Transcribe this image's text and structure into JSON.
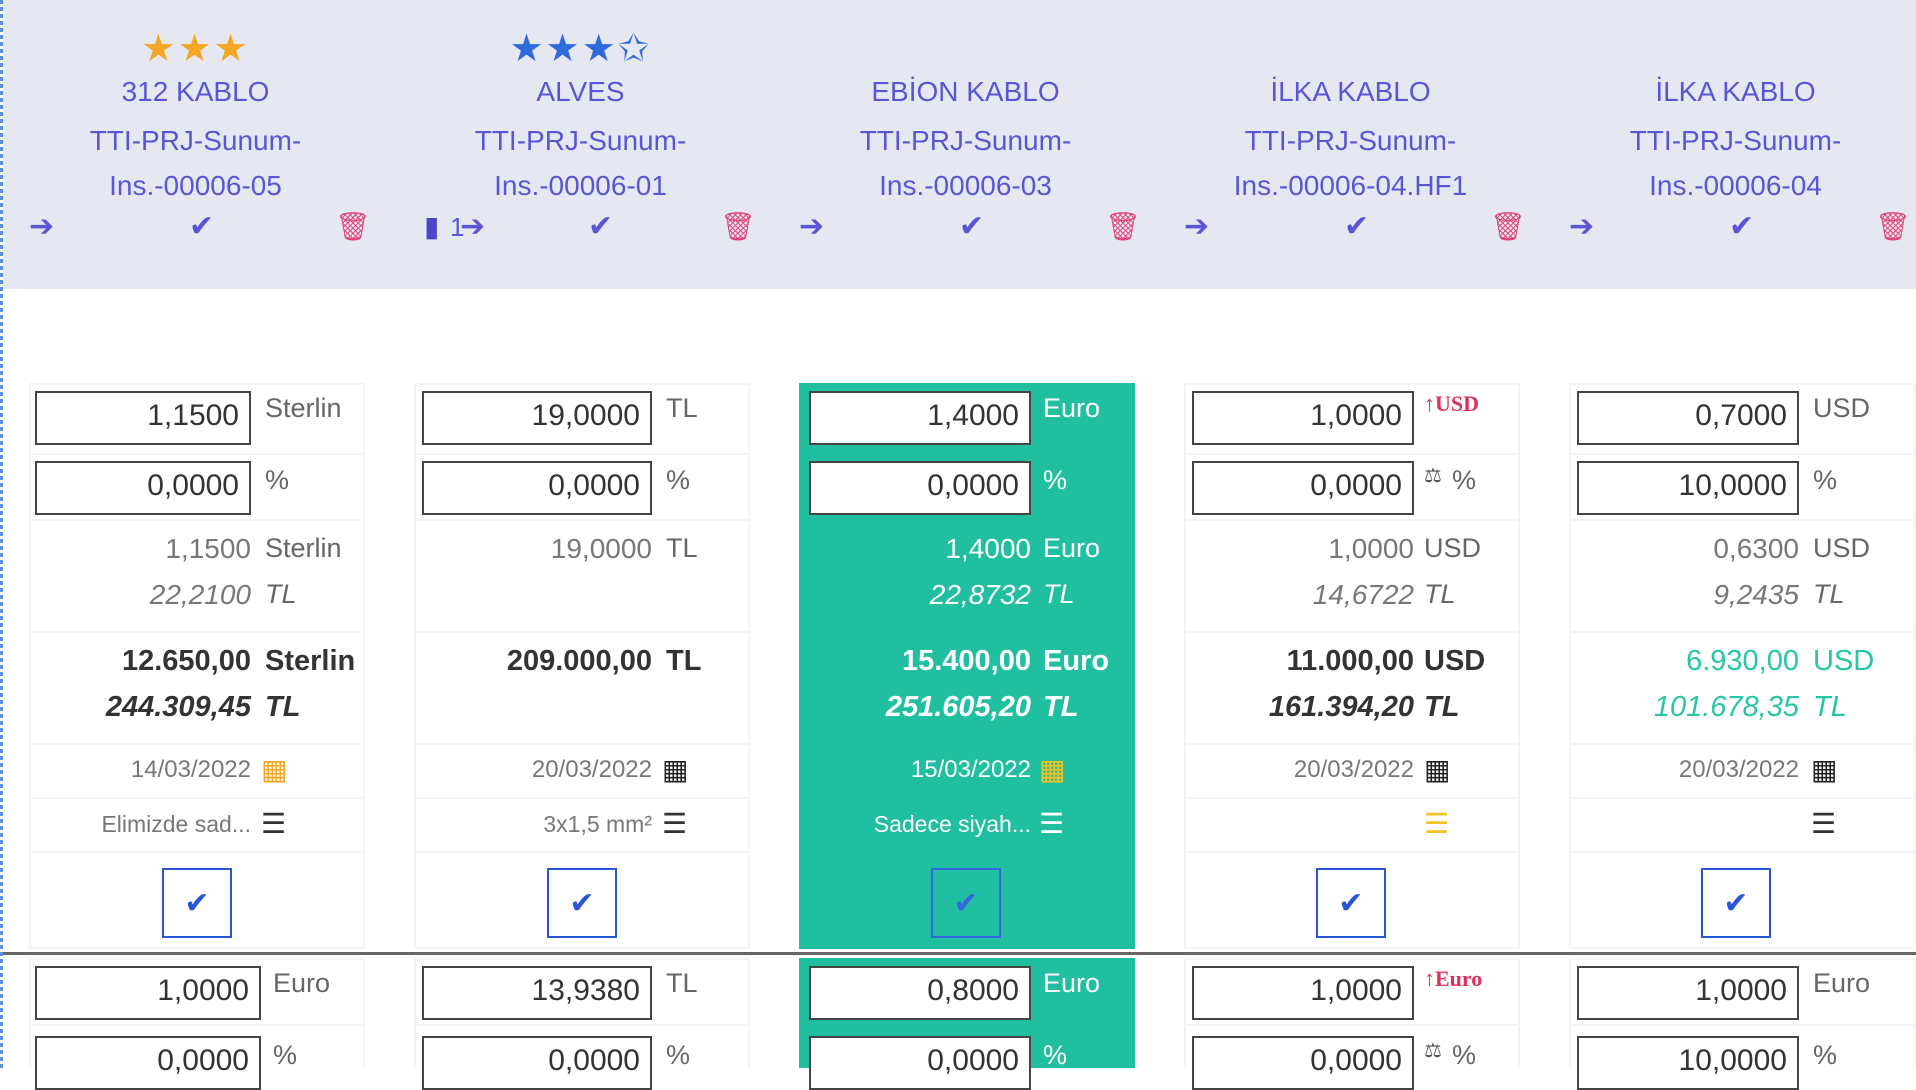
{
  "suppliers": [
    {
      "stars": "★★★",
      "name": "312 KABLO",
      "ref1": "TTI-PRJ-Sunum-",
      "ref2": "Ins.-00006-05"
    },
    {
      "stars": "★★★✩",
      "name": "ALVES",
      "ref1": "TTI-PRJ-Sunum-",
      "ref2": "Ins.-00006-01",
      "doc_label": "1"
    },
    {
      "stars": "",
      "name": "EBİON KABLO",
      "ref1": "TTI-PRJ-Sunum-",
      "ref2": "Ins.-00006-03"
    },
    {
      "stars": "",
      "name": "İLKA KABLO",
      "ref1": "TTI-PRJ-Sunum-",
      "ref2": "Ins.-00006-04.HF1"
    },
    {
      "stars": "",
      "name": "İLKA KABLO",
      "ref1": "TTI-PRJ-Sunum-",
      "ref2": "Ins.-00006-04"
    }
  ],
  "icons": {
    "arrow": "arrow-right-icon",
    "check": "check-icon",
    "trash": "trash-icon",
    "calendar": "calendar-icon",
    "comment": "comment-icon",
    "file": "file-icon"
  },
  "row1": [
    {
      "price": "1,1500",
      "currency": "Sterlin",
      "discount": "0,0000",
      "pct": "%",
      "net": "1,1500",
      "net_cur": "Sterlin",
      "net_tl": "22,2100",
      "tl": "TL",
      "total": "12.650,00",
      "total_cur": "Sterlin",
      "total_tl": "244.309,45",
      "date": "14/03/2022",
      "note": "Elimizde sad..."
    },
    {
      "price": "19,0000",
      "currency": "TL",
      "discount": "0,0000",
      "pct": "%",
      "net": "19,0000",
      "net_cur": "TL",
      "net_tl": "",
      "tl": "",
      "total": "209.000,00",
      "total_cur": "TL",
      "total_tl": "",
      "date": "20/03/2022",
      "note": "3x1,5 mm²"
    },
    {
      "price": "1,4000",
      "currency": "Euro",
      "discount": "0,0000",
      "pct": "%",
      "net": "1,4000",
      "net_cur": "Euro",
      "net_tl": "22,8732",
      "tl": "TL",
      "total": "15.400,00",
      "total_cur": "Euro",
      "total_tl": "251.605,20",
      "date": "15/03/2022",
      "note": "Sadece siyah..."
    },
    {
      "price": "1,0000",
      "currency": "↑USD",
      "discount": "0,0000",
      "pct": "%",
      "net": "1,0000",
      "net_cur": "USD",
      "net_tl": "14,6722",
      "tl": "TL",
      "total": "11.000,00",
      "total_cur": "USD",
      "total_tl": "161.394,20",
      "date": "20/03/2022",
      "note": ""
    },
    {
      "price": "0,7000",
      "currency": "USD",
      "discount": "10,0000",
      "pct": "%",
      "net": "0,6300",
      "net_cur": "USD",
      "net_tl": "9,2435",
      "tl": "TL",
      "total": "6.930,00",
      "total_cur": "USD",
      "total_tl": "101.678,35",
      "date": "20/03/2022",
      "note": ""
    }
  ],
  "row2": [
    {
      "price": "1,0000",
      "currency": "Euro",
      "discount": "0,0000",
      "pct": "%"
    },
    {
      "price": "13,9380",
      "currency": "TL",
      "discount": "0,0000",
      "pct": "%"
    },
    {
      "price": "0,8000",
      "currency": "Euro",
      "discount": "0,0000",
      "pct": "%"
    },
    {
      "price": "1,0000",
      "currency": "↑Euro",
      "discount": "0,0000",
      "pct": "%"
    },
    {
      "price": "1,0000",
      "currency": "Euro",
      "discount": "10,0000",
      "pct": "%"
    }
  ],
  "colors": {
    "header_bg": "#e6e8f1",
    "accent": "#5a55d6",
    "selected": "#1fbf9f",
    "trash": "#e0457b",
    "star_orange": "#f5a623",
    "star_blue": "#2f6bdc",
    "best_price": "#27c6a4"
  }
}
